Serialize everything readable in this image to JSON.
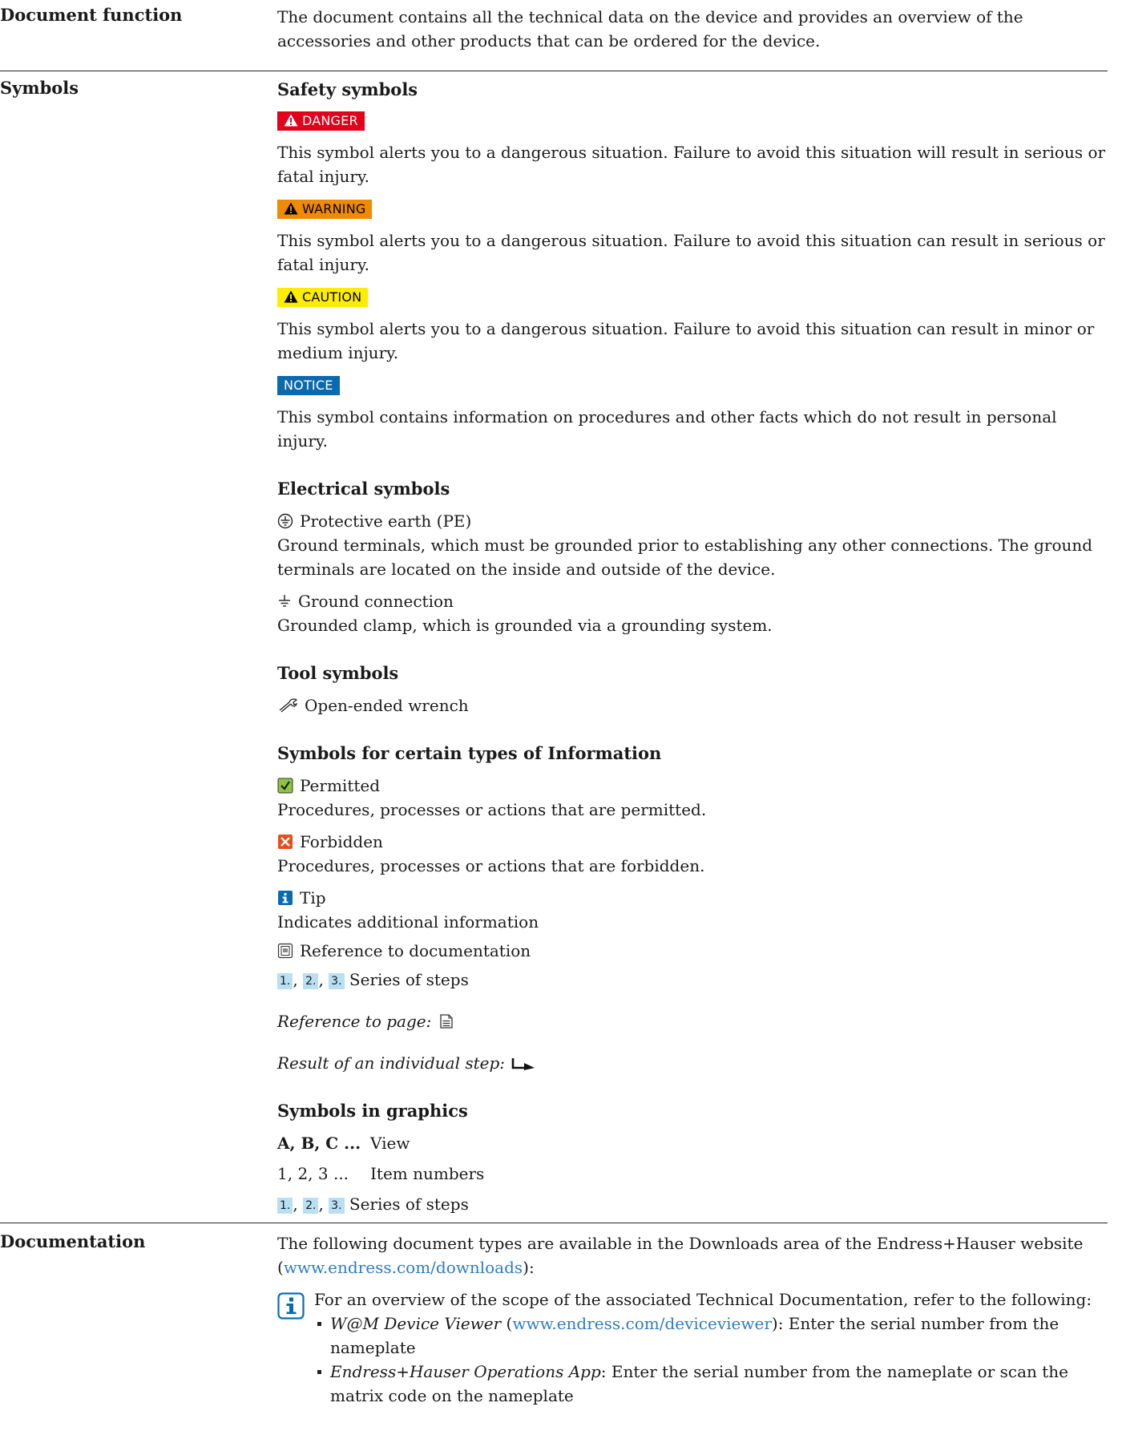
{
  "sections": {
    "doc_function": {
      "label": "Document function",
      "text": "The document contains all the technical data on the device and provides an overview of the accessories and other products that can be ordered for the device."
    },
    "symbols": {
      "label": "Symbols",
      "safety": {
        "heading": "Safety symbols",
        "danger": {
          "badge": "DANGER",
          "text": "This symbol alerts you to a dangerous situation. Failure to avoid this situation will result in serious or fatal injury."
        },
        "warning": {
          "badge": "WARNING",
          "text": "This symbol alerts you to a dangerous situation. Failure to avoid this situation can result in serious or fatal injury."
        },
        "caution": {
          "badge": "CAUTION",
          "text": "This symbol alerts you to a dangerous situation. Failure to avoid this situation can result in minor or medium injury."
        },
        "notice": {
          "badge": "NOTICE",
          "text": "This symbol contains information on procedures and other facts which do not result in personal injury."
        }
      },
      "electrical": {
        "heading": "Electrical symbols",
        "pe_title": "Protective earth (PE)",
        "pe_text": "Ground terminals, which must be grounded prior to establishing any other connections. The ground terminals are located on the inside and outside of the device.",
        "ground_title": "Ground connection",
        "ground_text": "Grounded clamp, which is grounded via a grounding system."
      },
      "tool": {
        "heading": "Tool symbols",
        "wrench": "Open-ended wrench"
      },
      "info": {
        "heading": "Symbols for certain types of Information",
        "permitted_title": "Permitted",
        "permitted_text": "Procedures, processes or actions that are permitted.",
        "forbidden_title": "Forbidden",
        "forbidden_text": "Procedures, processes or actions that are forbidden.",
        "tip_title": "Tip",
        "tip_text": "Indicates additional information",
        "reference_doc": "Reference to documentation",
        "steps_label": "Series of steps",
        "reference_page": "Reference to page:",
        "result_step": "Result of an individual step:"
      },
      "graphics": {
        "heading": "Symbols in graphics",
        "view_key": "A, B, C ...",
        "view_label": "View",
        "items_key": "1, 2, 3 ...",
        "items_label": "Item numbers",
        "steps_label": "Series of steps"
      },
      "step_numbers": [
        "1.",
        "2.",
        "3."
      ]
    },
    "documentation": {
      "label": "Documentation",
      "intro_before": "The following document types are available in the Downloads area of the Endress+Hauser website (",
      "intro_link": "www.endress.com/downloads",
      "intro_after": "):",
      "tip_text": "For an overview of the scope of the associated Technical Documentation, refer to the following:",
      "bullet1_title": "W@M Device Viewer",
      "bullet1_open": " (",
      "bullet1_link": "www.endress.com/deviceviewer",
      "bullet1_after": "): Enter the serial number from the nameplate",
      "bullet2_title": "Endress+Hauser Operations App",
      "bullet2_after": ": Enter the serial number from the nameplate or scan the matrix code on the nameplate"
    }
  },
  "colors": {
    "danger": "#e2001a",
    "warning": "#f08a00",
    "caution": "#ffed00",
    "notice": "#0a6ab0",
    "link": "#2d7cc4",
    "step": "#b9dff3"
  }
}
